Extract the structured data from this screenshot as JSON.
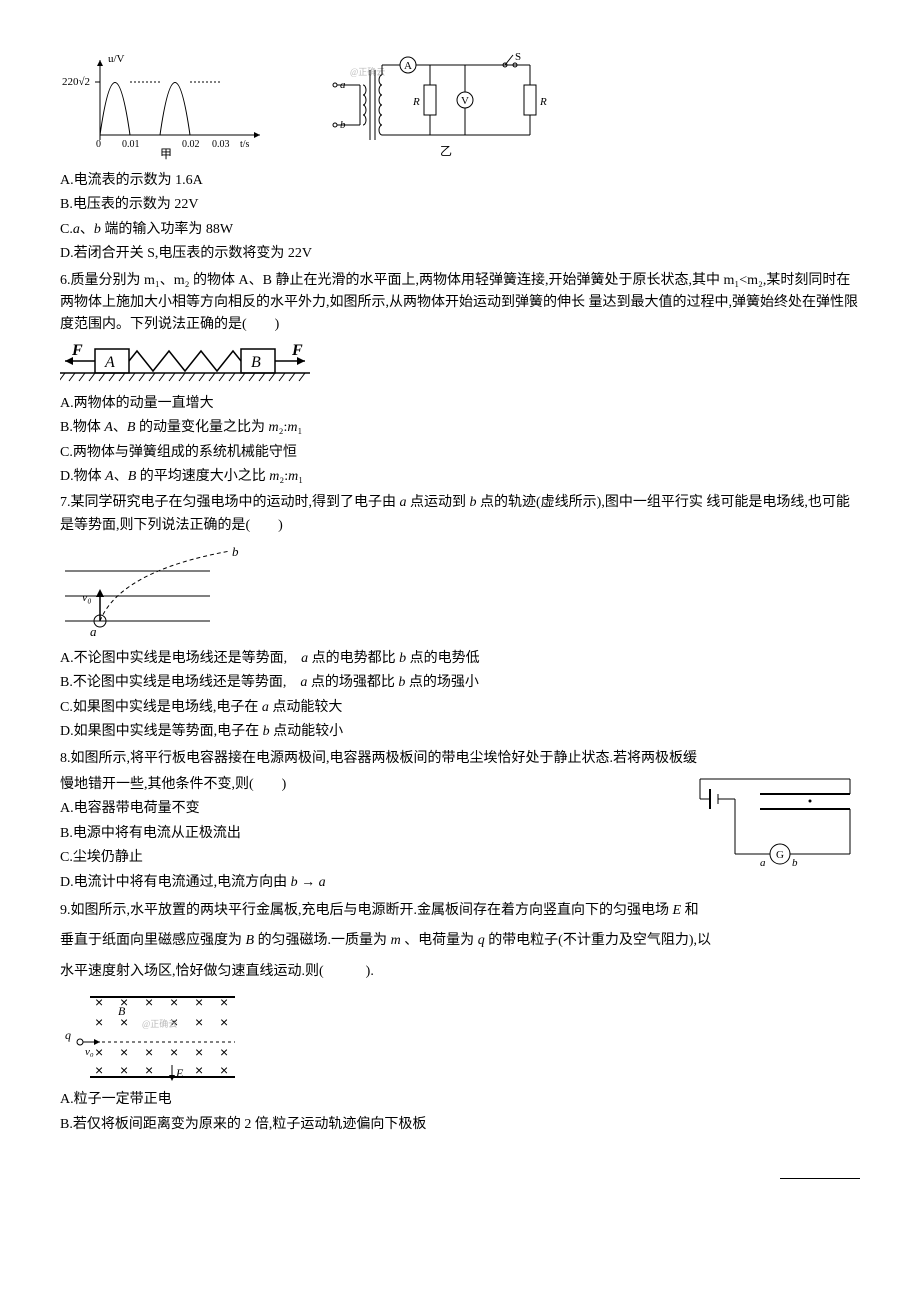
{
  "fig1": {
    "yAxis": "u/V",
    "yVal": "220√2",
    "xVals": [
      "0",
      "0.01",
      "0.02",
      "0.03"
    ],
    "xAxis": "t/s",
    "caption": "甲",
    "watermark": "@正确云",
    "labels": {
      "a": "a",
      "b": "b",
      "A": "A",
      "V": "V",
      "R1": "R",
      "R2": "R",
      "S": "S"
    },
    "caption2": "乙"
  },
  "q5opts": {
    "A": "A.电流表的示数为 1.6A",
    "B": "B.电压表的示数为 22V",
    "C": "C.a、b 端的输入功率为 88W",
    "D": "D.若闭合开关 S,电压表的示数将变为 22V"
  },
  "q6": {
    "stem1": "6.质量分别为 m₁、m₂ 的物体 A、B 静止在光滑的水平面上,两物体用轻弹簧连接,开始弹簧处于原长状态,其中",
    "stem2": "m₁<m₂,某时刻同时在两物体上施加大小相等方向相反的水平外力,如图所示,从两物体开始运动到弹簧的伸长",
    "stem3": "量达到最大值的过程中,弹簧始终处在弹性限度范围内。下列说法正确的是(　　)",
    "fig": {
      "F1": "F",
      "A": "A",
      "B": "B",
      "F2": "F"
    },
    "opts": {
      "A": "A.两物体的动量一直增大",
      "B": "B.物体 A、B 的动量变化量之比为 m₂:m₁",
      "C": "C.两物体与弹簧组成的系统机械能守恒",
      "D": "D.物体 A、B 的平均速度大小之比 m₂:m₁"
    }
  },
  "q7": {
    "stem1": "7.某同学研究电子在匀强电场中的运动时,得到了电子由 a 点运动到 b 点的轨迹(虚线所示),图中一组平行实",
    "stem2": "线可能是电场线,也可能是等势面,则下列说法正确的是(　　)",
    "fig": {
      "v0": "v₀",
      "a": "a",
      "b": "b"
    },
    "opts": {
      "A": "A.不论图中实线是电场线还是等势面,  a 点的电势都比 b 点的电势低",
      "B": "B.不论图中实线是电场线还是等势面,  a 点的场强都比 b 点的场强小",
      "C": "C.如果图中实线是电场线,电子在 a 点动能较大",
      "D": "D.如果图中实线是等势面,电子在 b 点动能较小"
    }
  },
  "q8": {
    "stem1": "8.如图所示,将平行板电容器接在电源两极间,电容器两极板间的带电尘埃恰好处于静止状态.若将两极板缓",
    "stem2": "慢地错开一些,其他条件不变,则(　　)",
    "fig": {
      "a": "a",
      "b": "b",
      "G": "G"
    },
    "opts": {
      "A": "A.电容器带电荷量不变",
      "B": "B.电源中将有电流从正极流出",
      "C": "C.尘埃仍静止",
      "D": "D.电流计中将有电流通过,电流方向由 b → a"
    }
  },
  "q9": {
    "stem1": "9.如图所示,水平放置的两块平行金属板,充电后与电源断开.金属板间存在着方向竖直向下的匀强电场 E 和",
    "stem2": "垂直于纸面向里磁感应强度为 B 的匀强磁场.一质量为 m 、电荷量为 q 的带电粒子(不计重力及空气阻力),以",
    "stem3": "水平速度射入场区,恰好做匀速直线运动.则(　　　).",
    "fig": {
      "B": "B",
      "E": "E",
      "q": "q",
      "v0": "v₀",
      "watermark": "@正确云"
    },
    "opts": {
      "A": "A.粒子一定带正电",
      "B": "B.若仅将板间距离变为原来的 2 倍,粒子运动轨迹偏向下极板"
    }
  }
}
